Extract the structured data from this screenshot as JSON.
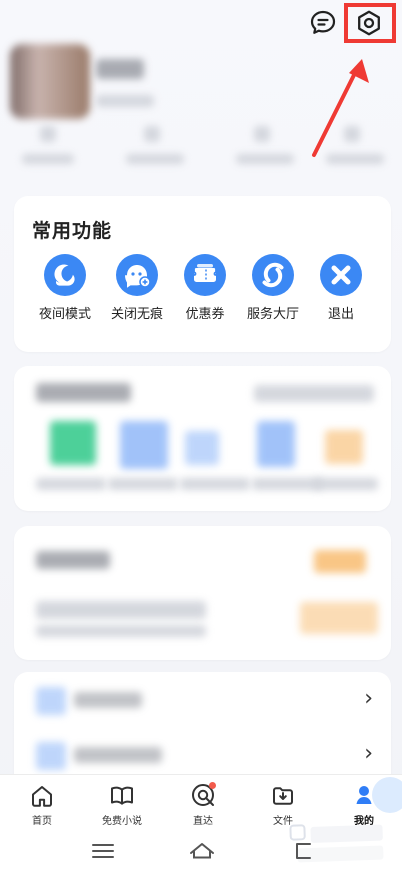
{
  "common": {
    "title": "常用功能",
    "items": [
      {
        "label": "夜间模式",
        "icon": "night-mode-icon"
      },
      {
        "label": "关闭无痕",
        "icon": "incognito-icon"
      },
      {
        "label": "优惠券",
        "icon": "coupon-icon"
      },
      {
        "label": "服务大厅",
        "icon": "service-hall-icon"
      },
      {
        "label": "退出",
        "icon": "exit-icon"
      }
    ]
  },
  "bottom_nav": {
    "items": [
      {
        "label": "首页",
        "icon": "home-icon"
      },
      {
        "label": "免费小说",
        "icon": "book-icon"
      },
      {
        "label": "直达",
        "icon": "direct-icon"
      },
      {
        "label": "文件",
        "icon": "file-icon"
      },
      {
        "label": "我的",
        "icon": "profile-icon"
      }
    ]
  },
  "system_bar": {
    "icons": [
      "menu-icon",
      "home-icon",
      "back-icon"
    ]
  },
  "colors": {
    "accent": "#3b88f4",
    "highlight": "#ef3a34"
  }
}
